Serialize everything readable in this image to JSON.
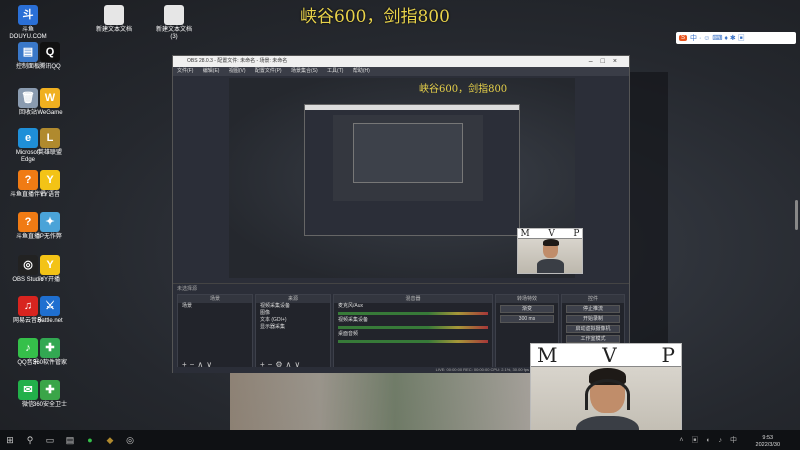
{
  "overlay_title": "峡谷600，剑指800",
  "desktop_icons": [
    {
      "label": "斗鱼\nDOUYU.COM",
      "color": "#2a6fd6",
      "glyph": "斗",
      "icon": "douyu-logo-icon"
    },
    {
      "label": "新建文本文档",
      "color": "#e6e6e6",
      "glyph": "",
      "icon": "text-file-icon"
    },
    {
      "label": "新建文本文档\n(3)",
      "color": "#e6e6e6",
      "glyph": "",
      "icon": "text-file-icon"
    },
    {
      "label": "控制面板",
      "color": "#3a78c9",
      "glyph": "▤",
      "icon": "control-panel-icon"
    },
    {
      "label": "腾讯QQ",
      "color": "#111",
      "glyph": "Q",
      "icon": "qq-icon"
    },
    {
      "label": "回收站",
      "color": "#8a9bb0",
      "glyph": "🗑",
      "icon": "recycle-bin-icon"
    },
    {
      "label": "WeGame",
      "color": "#f0b020",
      "glyph": "W",
      "icon": "wegame-icon"
    },
    {
      "label": "Microsoft\nEdge",
      "color": "#1f8fd8",
      "glyph": "e",
      "icon": "edge-icon"
    },
    {
      "label": "英雄联盟",
      "color": "#b08a2e",
      "glyph": "L",
      "icon": "lol-icon"
    },
    {
      "label": "斗鱼直播伴侣",
      "color": "#f07b14",
      "glyph": "?",
      "icon": "douyu-companion-icon"
    },
    {
      "label": "YY语音",
      "color": "#f3c316",
      "glyph": "Y",
      "icon": "yy-icon"
    },
    {
      "label": "斗鱼直播",
      "color": "#f07b14",
      "glyph": "?",
      "icon": "douyu-live-icon"
    },
    {
      "label": "IP无作弊",
      "color": "#4aa3d8",
      "glyph": "✦",
      "icon": "ip-tool-icon"
    },
    {
      "label": "OBS Studio",
      "color": "#222",
      "glyph": "◎",
      "icon": "obs-icon"
    },
    {
      "label": "YY开播",
      "color": "#f3c316",
      "glyph": "Y",
      "icon": "yy-live-icon"
    },
    {
      "label": "网易云音乐",
      "color": "#d8241f",
      "glyph": "♫",
      "icon": "netease-music-icon"
    },
    {
      "label": "Battle.net",
      "color": "#1f6fd0",
      "glyph": "⚔",
      "icon": "battlenet-icon"
    },
    {
      "label": "QQ音乐",
      "color": "#35c04a",
      "glyph": "♪",
      "icon": "qq-music-icon"
    },
    {
      "label": "360软件管家",
      "color": "#32a852",
      "glyph": "✚",
      "icon": "360-manager-icon"
    },
    {
      "label": "微信",
      "color": "#22b04a",
      "glyph": "✉",
      "icon": "wechat-icon"
    },
    {
      "label": "360安全卫士",
      "color": "#3aa548",
      "glyph": "✚",
      "icon": "360-security-icon"
    }
  ],
  "obs": {
    "title": "OBS 28.0.3 - 配置文件: 未命名 - 场景: 未命名",
    "menu": [
      "文件(F)",
      "编辑(E)",
      "视图(V)",
      "配置文件(P)",
      "场景集合(S)",
      "工具(T)",
      "帮助(H)"
    ],
    "preview_title": "峡谷600，剑指800",
    "scenes_header": "场景",
    "scenes": [
      "场景"
    ],
    "sources_header": "来源",
    "sources": [
      "视频采集设备",
      "图像",
      "文本 (GDI+)",
      "显示器采集"
    ],
    "mixer_header": "混音器",
    "mixer": [
      {
        "name": "麦克风/Aux",
        "db": "0.0 dB"
      },
      {
        "name": "视频采集设备",
        "db": "0.0 dB"
      },
      {
        "name": "桌面音频",
        "db": "0.0 dB"
      }
    ],
    "transitions_header": "转场特效",
    "transition_type": "渐变",
    "transition_duration": "300 ms",
    "controls_header": "控件",
    "controls": [
      "停止推流",
      "开始录制",
      "启动虚拟摄像机",
      "工作室模式"
    ],
    "status": "LIVE: 00:00:00  REC: 00:00:00  CPU: 2.1%, 30.00 fps",
    "no_source": "未选择源"
  },
  "webcam_letters": [
    "M",
    "V",
    "P"
  ],
  "tray": {
    "badge": "S",
    "icons": "中 · ☺ ⌨ ♦ ✱ ▣"
  },
  "clock": {
    "time": "9:53",
    "date": "2022/3/30"
  }
}
